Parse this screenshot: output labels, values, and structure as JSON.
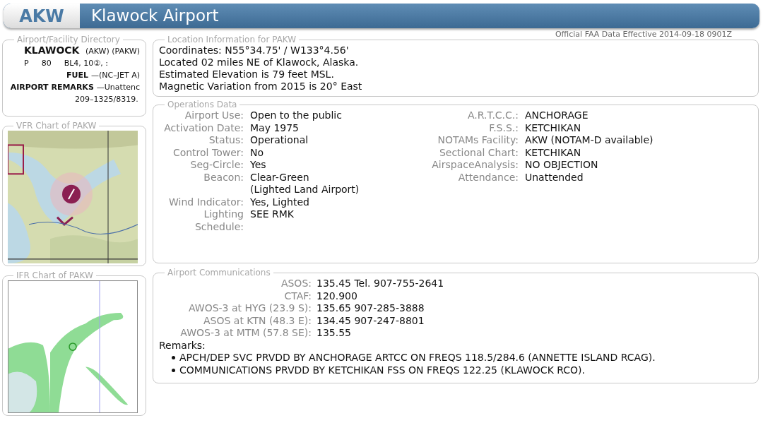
{
  "header": {
    "code": "AKW",
    "title": "Klawock Airport"
  },
  "effective_note": "Official FAA Data Effective 2014-09-18 0901Z",
  "directory": {
    "title": "Airport/Facility Directory",
    "lines": [
      {
        "kind": "heading",
        "segments": [
          {
            "text": "KLAWOCK",
            "bold": true
          },
          {
            "text": "(AKW) (PAKW)",
            "bold": false
          }
        ]
      },
      {
        "kind": "columns",
        "segments": [
          {
            "text": "P",
            "bold": false
          },
          {
            "text": "80",
            "bold": false
          },
          {
            "text": "BL4, 10②, :",
            "bold": false
          }
        ]
      },
      {
        "kind": "entry",
        "segments": [
          {
            "text": "FUEL",
            "bold": true
          },
          {
            "text": "—(NC–JET A)",
            "bold": false
          }
        ]
      },
      {
        "kind": "entry",
        "segments": [
          {
            "text": "AIRPORT REMARKS",
            "bold": true
          },
          {
            "text": "—Unattenc",
            "bold": false
          }
        ]
      },
      {
        "kind": "continuation",
        "segments": [
          {
            "text": "209–1325/8319.",
            "bold": false
          }
        ]
      }
    ]
  },
  "vfr_chart": {
    "title": "VFR Chart of PAKW"
  },
  "ifr_chart": {
    "title": "IFR Chart of PAKW"
  },
  "location": {
    "title": "Location Information for PAKW",
    "lines": [
      "Coordinates: N55°34.75' / W133°4.56'",
      "Located 02 miles NE of Klawock, Alaska.",
      "Estimated Elevation is 79 feet MSL.",
      "Magnetic Variation from 2015 is 20° East"
    ]
  },
  "operations": {
    "title": "Operations Data",
    "left": [
      {
        "label": "Airport Use:",
        "value": [
          "Open to the public"
        ]
      },
      {
        "label": "Activation Date:",
        "value": [
          "May 1975"
        ]
      },
      {
        "label": "Status:",
        "value": [
          "Operational"
        ]
      },
      {
        "label": "Control Tower:",
        "value": [
          "No"
        ]
      },
      {
        "label": "Seg-Circle:",
        "value": [
          "Yes"
        ]
      },
      {
        "label": "Beacon:",
        "value": [
          "Clear-Green",
          "(Lighted Land Airport)"
        ]
      },
      {
        "label": "Wind Indicator:",
        "value": [
          "Yes, Lighted"
        ]
      },
      {
        "label": "Lighting Schedule:",
        "value": [
          "SEE RMK"
        ]
      }
    ],
    "right": [
      {
        "label": "A.R.T.C.C.:",
        "value": [
          "ANCHORAGE"
        ]
      },
      {
        "label": "F.S.S.:",
        "value": [
          "KETCHIKAN"
        ]
      },
      {
        "label": "NOTAMs Facility:",
        "value": [
          "AKW (NOTAM-D available)"
        ]
      },
      {
        "label": "Sectional Chart:",
        "value": [
          "KETCHIKAN"
        ]
      },
      {
        "label": "AirspaceAnalysis:",
        "value": [
          "NO OBJECTION"
        ]
      },
      {
        "label": "Attendance:",
        "value": [
          "Unattended"
        ]
      }
    ]
  },
  "communications": {
    "title": "Airport Communications",
    "rows": [
      {
        "label": "ASOS:",
        "value": "135.45 Tel. 907-755-2641"
      },
      {
        "label": "CTAF:",
        "value": "120.900"
      },
      {
        "label": "AWOS-3 at HYG (23.9 S):",
        "value": "135.65 907-285-3888"
      },
      {
        "label": "ASOS at KTN (48.3 E):",
        "value": "134.45 907-247-8801"
      },
      {
        "label": "AWOS-3 at MTM (57.8 SE):",
        "value": "135.55"
      }
    ],
    "remarks_label": "Remarks:",
    "remarks": [
      "APCH/DEP SVC PRVDD BY ANCHORAGE ARTCC ON FREQS 118.5/284.6 (ANNETTE ISLAND RCAG).",
      "COMMUNICATIONS PRVDD BY KETCHIKAN FSS ON FREQS 122.25 (KLAWOCK RCO)."
    ]
  }
}
